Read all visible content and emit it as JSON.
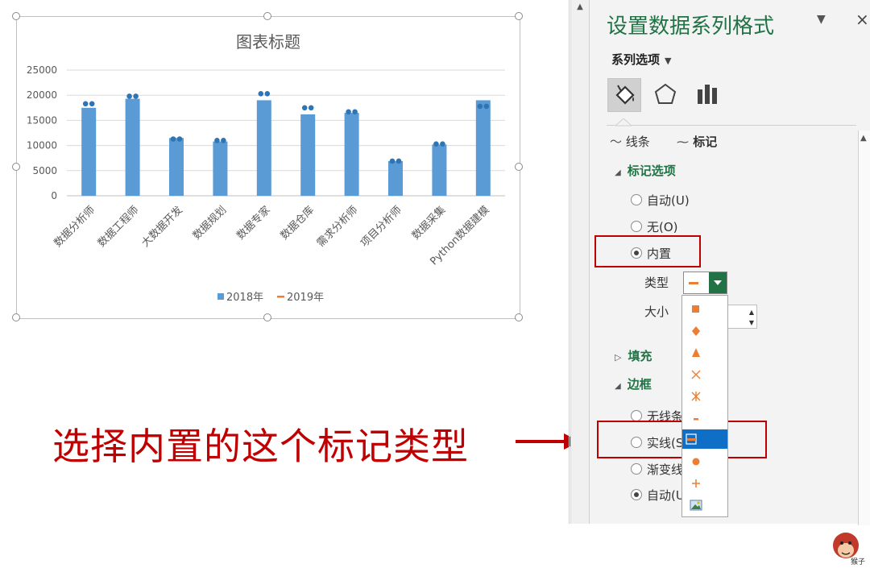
{
  "chart_data": {
    "type": "bar",
    "title": "图表标题",
    "categories": [
      "数据分析师",
      "数据工程师",
      "大数据开发",
      "数据规划",
      "数据专家",
      "数据仓库",
      "需求分析师",
      "项目分析师",
      "数据采集",
      "Python数据建模"
    ],
    "series": [
      {
        "name": "2018年",
        "values": [
          17500,
          19300,
          11500,
          10800,
          19000,
          16200,
          16500,
          6900,
          10200,
          19000
        ],
        "color": "#5b9bd5"
      },
      {
        "name": "2019年",
        "values": [
          18300,
          19800,
          11300,
          11000,
          20300,
          17500,
          16700,
          6900,
          10300,
          17800
        ],
        "color": "#ed7d31",
        "marker_color": "#2e75b6"
      }
    ],
    "yticks": [
      "25000",
      "20000",
      "15000",
      "10000",
      "5000",
      "0"
    ],
    "ylim": [
      0,
      25000
    ],
    "grid": true,
    "legend": "bottom"
  },
  "annotation": {
    "text": "选择内置的这个标记类型"
  },
  "panel": {
    "title": "设置数据系列格式",
    "close": "×",
    "series_options": "系列选项",
    "subtab_line": "线条",
    "subtab_marker": "标记",
    "marker_options": "标记选项",
    "opt_auto": "自动(U)",
    "opt_none": "无(O)",
    "opt_builtin": "内置",
    "type_label": "类型",
    "size_label": "大小",
    "fill": "填充",
    "border": "边框",
    "border_none": "无线条",
    "border_solid": "实线(S)",
    "border_gradient": "渐变线",
    "border_auto": "自动(U)"
  },
  "colors": {
    "accent": "#217346",
    "highlight": "#c00000",
    "selected": "#0f6fc6",
    "marker": "#ed7d31"
  },
  "marker_types": [
    "square",
    "diamond",
    "triangle",
    "x",
    "star",
    "short-dash",
    "long-dash",
    "circle",
    "plus",
    "picture"
  ],
  "watermark": "猴子"
}
